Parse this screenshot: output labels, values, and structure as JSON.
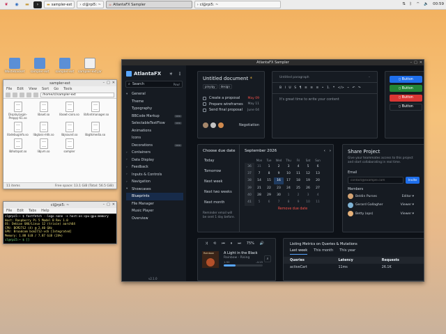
{
  "taskbar": {
    "tasks": [
      {
        "label": "sampler-ext",
        "active": false
      },
      {
        "label": "cl@rpi5: ~",
        "active": false
      },
      {
        "label": "AtlantaFX Sampler",
        "active": true
      },
      {
        "label": "cl@rpi5: ~",
        "active": false
      }
    ],
    "clock": "00:59"
  },
  "desktop_icons": [
    {
      "label": "Wastebasket",
      "icon": "trash-icon"
    },
    {
      "label": "sampler-ext",
      "icon": "folder-icon"
    },
    {
      "label": "sampler-ext",
      "icon": "folder-icon"
    },
    {
      "label": "sampler-ext.jar",
      "icon": "jar-icon"
    }
  ],
  "file_manager": {
    "title": "sampler-ext",
    "menu": [
      "File",
      "Edit",
      "View",
      "Sort",
      "Go",
      "Tools"
    ],
    "path": "/home/cl/sampler-ext",
    "files": [
      "DisplayLogin-Preppy-61.so",
      "libswt.so",
      "libswt-cairo.so",
      "libfontmanager.so",
      "libdebuginfo.so",
      "libglass-mtk.so",
      "libjsound.so",
      "libgtkmedia.so",
      "libhotspot.so",
      "libjvm.so",
      "sampler"
    ],
    "status_left": "11 items",
    "status_right": "Free space: 13.1 GiB (Total: 56.5 GiB)"
  },
  "terminal": {
    "title": "cl@rpi5: ~",
    "menu": [
      "File",
      "Edit",
      "Tabs",
      "Help"
    ],
    "lines": [
      "cl@rpi5:~ $ fastfetch --logo none -s host:os:cpu:gpu:memory",
      "Host: Raspberry Pi 5 Model B Rev 1.0",
      "OS: Debian GNU/Linux 12 (trixie) aarch64",
      "CPU: BCM2712 (4) @ 2.40 GHz",
      "GPU: Broadcom bcm2712-vc6 [Integrated]",
      "Memory: 1.88 GiB / 7.87 GiB (24%)",
      "cl@rpi5:~ $ []"
    ]
  },
  "app": {
    "title": "AtlantaFX Sampler",
    "logo_text": "AtlantaFX",
    "search_label": "Search",
    "search_shortcut": "Pow/",
    "nav": [
      {
        "label": "General",
        "level": 0,
        "expanded": true
      },
      {
        "label": "Theme",
        "level": 1
      },
      {
        "label": "Typography",
        "level": 1
      },
      {
        "label": "BBCode Markup",
        "level": 1,
        "badge": "new"
      },
      {
        "label": "SelectableTextFlow",
        "level": 1,
        "badge": "new"
      },
      {
        "label": "Animations",
        "level": 1
      },
      {
        "label": "Icons",
        "level": 1
      },
      {
        "label": "Decorations",
        "level": 1,
        "badge": "new"
      },
      {
        "label": "Containers",
        "level": 0
      },
      {
        "label": "Data Display",
        "level": 0
      },
      {
        "label": "Feedback",
        "level": 0
      },
      {
        "label": "Inputs & Controls",
        "level": 0
      },
      {
        "label": "Navigation",
        "level": 0
      },
      {
        "label": "Showcases",
        "level": 0,
        "expanded": true
      },
      {
        "label": "Blueprints",
        "level": 1,
        "selected": true
      },
      {
        "label": "File Manager",
        "level": 1
      },
      {
        "label": "Music Player",
        "level": 1
      },
      {
        "label": "Overview",
        "level": 1
      }
    ],
    "version": "v2.1.0"
  },
  "doc_card": {
    "title": "Untitled document",
    "tags": [
      "pinyiqy",
      "design"
    ],
    "tasks": [
      {
        "label": "Create a proposal",
        "date": "May 09",
        "highlight": true
      },
      {
        "label": "Prepare wireframes",
        "date": "May 11",
        "highlight": false
      },
      {
        "label": "Send final proposal",
        "date": "June 04",
        "highlight": false
      }
    ],
    "footer_label": "Negotiation"
  },
  "editor_card": {
    "paragraph_label": "Untitled paragraph",
    "body_text": "It's great time to write your content",
    "toolbar": [
      "B",
      "I",
      "U",
      "S",
      "¶",
      "≡",
      "≡",
      "≡",
      "•",
      "1.",
      "❝",
      "</>",
      "⌁",
      "↶",
      "↷"
    ]
  },
  "buttons_card": {
    "buttons": [
      {
        "label": "Button",
        "color": "#1f6feb",
        "border": false
      },
      {
        "label": "Button",
        "color": "#238636",
        "border": false
      },
      {
        "label": "Button",
        "color": "#da3633",
        "border": false
      },
      {
        "label": "Button",
        "color": "#161b22",
        "border": true
      }
    ]
  },
  "due_card": {
    "title": "Choose due date",
    "options": [
      "Today",
      "Tomorrow",
      "Next week",
      "Next two weeks",
      "Next month"
    ],
    "reminder_text": "Reminder email will be sent 1 day before.",
    "month": "September 2026",
    "weekdays": [
      "Mon",
      "Tue",
      "Wed",
      "Thu",
      "Fri",
      "Sat",
      "Sun"
    ],
    "weeks": [
      {
        "wk": "36",
        "days": [
          "31",
          "1",
          "2",
          "3",
          "4",
          "5",
          "6"
        ],
        "dim": [
          true,
          false,
          false,
          false,
          false,
          false,
          false
        ]
      },
      {
        "wk": "37",
        "days": [
          "7",
          "8",
          "9",
          "10",
          "11",
          "12",
          "13"
        ],
        "dim": [
          false,
          false,
          false,
          false,
          false,
          false,
          false
        ]
      },
      {
        "wk": "38",
        "days": [
          "14",
          "15",
          "16",
          "17",
          "18",
          "19",
          "20"
        ],
        "dim": [
          false,
          false,
          false,
          false,
          false,
          false,
          false
        ]
      },
      {
        "wk": "39",
        "days": [
          "21",
          "22",
          "23",
          "24",
          "25",
          "26",
          "27"
        ],
        "dim": [
          false,
          false,
          false,
          false,
          false,
          false,
          false
        ]
      },
      {
        "wk": "40",
        "days": [
          "28",
          "29",
          "30",
          "1",
          "2",
          "3",
          "4"
        ],
        "dim": [
          false,
          false,
          false,
          true,
          true,
          true,
          true
        ]
      },
      {
        "wk": "41",
        "days": [
          "5",
          "6",
          "7",
          "8",
          "9",
          "10",
          "11"
        ],
        "dim": [
          true,
          true,
          true,
          true,
          true,
          true,
          true
        ]
      }
    ],
    "today": "16",
    "remove_label": "Remove due date"
  },
  "share_card": {
    "title": "Share Project",
    "desc": "Give your teammates access to this project and start collaborating in real time.",
    "email_label": "Email",
    "email_placeholder": "contact@example.com",
    "invite_label": "Invite",
    "members_label": "Members",
    "members": [
      {
        "name": "Beldin Purses",
        "role": "Editor",
        "color": "#d4a373"
      },
      {
        "name": "Gerard Gallagher",
        "role": "Viewer",
        "color": "#7fb3d5"
      },
      {
        "name": "Betty (ops)",
        "role": "Viewer",
        "color": "#e6b27a"
      }
    ]
  },
  "player_card": {
    "controls": [
      "⤨",
      "⟲",
      "⏮",
      "⏸",
      "⏭",
      "75%",
      "🔊"
    ],
    "album_label": "Rainbow",
    "track": "A Light in the Black",
    "artist": "Rainbow - Rising",
    "time_cur": "1:50",
    "time_left": "-4:15",
    "progress": 0.3
  },
  "metrics_card": {
    "title": "Listing Metrics on Queries & Mutations",
    "tabs": [
      "Last week",
      "This month",
      "This year"
    ],
    "columns": [
      "Queries",
      "Latency",
      "Requests"
    ],
    "rows": [
      {
        "query": "activeCart",
        "latency": "11ms",
        "requests": "26.1K"
      }
    ]
  },
  "colors": {
    "accent": "#1f6feb",
    "app_bg": "#0d1117",
    "card_bg": "#161b22",
    "danger": "#f85149"
  }
}
